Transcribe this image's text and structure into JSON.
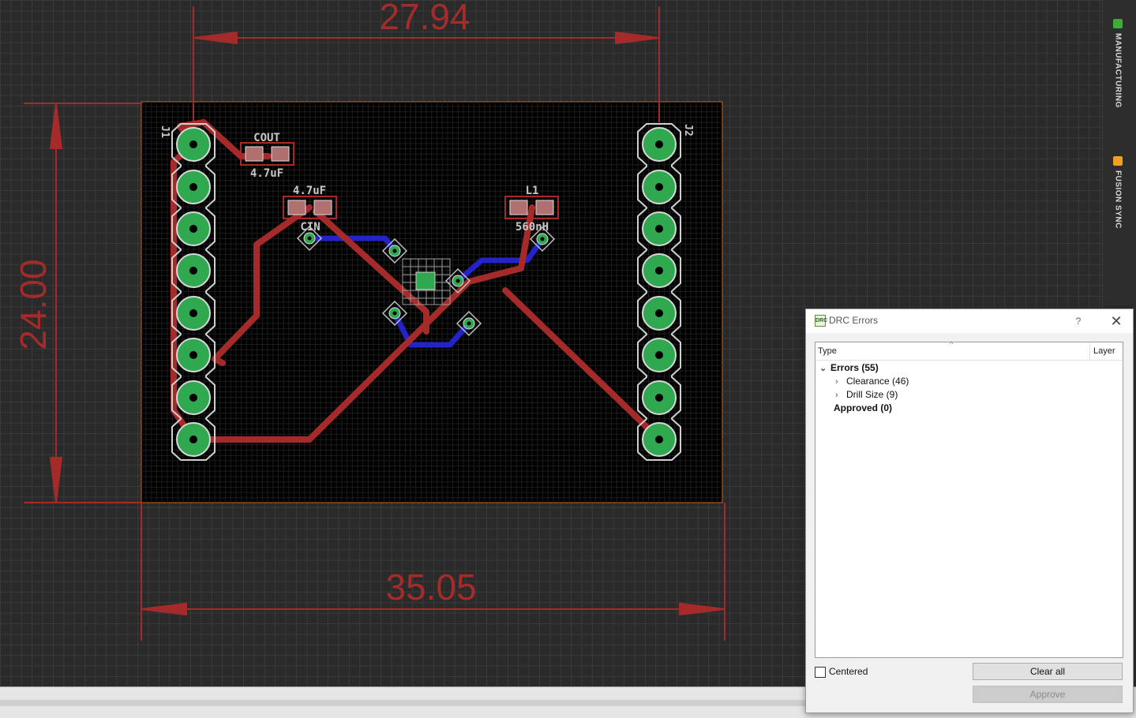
{
  "board": {
    "dimensions": {
      "top": "27.94",
      "left": "24.00",
      "bottom": "35.05"
    },
    "parts": {
      "cout": {
        "name": "COUT",
        "value": "4.7uF"
      },
      "cin": {
        "name": "CIN",
        "value": "4.7uF"
      },
      "l1": {
        "name": "L1",
        "value": "560nH"
      },
      "j1": {
        "name": "J1"
      },
      "j2": {
        "name": "J2"
      }
    },
    "colors": {
      "board": "#000000",
      "grid": "#3a3a3a",
      "top_copper": "#a52a2a",
      "bottom_copper": "#2323c8",
      "pad": "#2fa84f",
      "outline": "#c8691e",
      "dimension": "#a52a2a"
    }
  },
  "sidebar": {
    "tabs": [
      {
        "label": "MANUFACTURING",
        "icon": "manufacturing-icon",
        "color": "#3daa3a"
      },
      {
        "label": "FUSION SYNC",
        "icon": "fusion-sync-icon",
        "color": "#f0a020"
      }
    ]
  },
  "drc_dialog": {
    "title": "DRC Errors",
    "help": "?",
    "columns": {
      "type": "Type",
      "layer": "Layer"
    },
    "tree": {
      "errors": "Errors (55)",
      "clearance": "Clearance (46)",
      "drill_size": "Drill Size (9)",
      "approved": "Approved (0)"
    },
    "centered_label": "Centered",
    "centered_checked": false,
    "clear_all_label": "Clear all",
    "approve_label": "Approve"
  }
}
